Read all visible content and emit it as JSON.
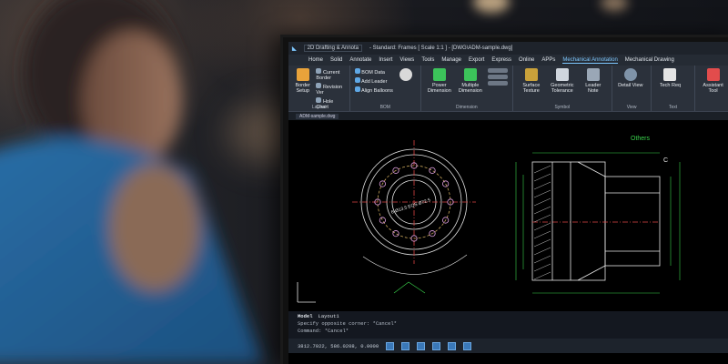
{
  "window": {
    "workspace": "2D Drafting & Annota",
    "title": "- Standard: Frames [ Scale 1:1 ] - [DWG\\ADM-sample.dwg]"
  },
  "menu": [
    "Home",
    "Solid",
    "Annotate",
    "Insert",
    "Views",
    "Tools",
    "Manage",
    "Export",
    "Express",
    "Online",
    "APPs",
    "Mechanical Annotation",
    "Mechanical Drawing"
  ],
  "ribbon": {
    "groups": [
      {
        "name": "Layout",
        "items": [
          "Border Setup",
          "Current Border",
          "Revision Ver",
          "Hole Chart"
        ]
      },
      {
        "name": "BOM",
        "items": [
          "BOM Data",
          "Add Leader",
          "Align Balloons",
          "Balloon"
        ]
      },
      {
        "name": "Dimension",
        "items": [
          "Power Dimension",
          "Multiple Dimension"
        ]
      },
      {
        "name": "Symbol",
        "items": [
          "Surface Texture",
          "Geometric Tolerance",
          "Leader Note"
        ]
      },
      {
        "name": "View",
        "items": [
          "Detail View"
        ]
      },
      {
        "name": "Text",
        "items": [
          "Tech Req"
        ]
      },
      {
        "name": "",
        "items": [
          "Assistant Tool"
        ]
      }
    ]
  },
  "doc_tab": "ADM-sample.dwg",
  "drawing": {
    "label_others": "Others",
    "label_c": "C",
    "dim_circle": "6-Ø13.5 EQS Ø72.5"
  },
  "command": {
    "tabs": [
      "Model",
      "Layout1"
    ],
    "lines": [
      "Specify opposite corner: *Cancel*",
      "Command: *Cancel*",
      "Command:"
    ]
  },
  "status": {
    "coords": "3812.7022, 586.0208, 0.0000"
  },
  "colors": {
    "drawing_lines": "#e6e6e6",
    "dimension": "#39d14b",
    "hatch": "#c9c9c9",
    "accent": "#7ec8ff"
  }
}
